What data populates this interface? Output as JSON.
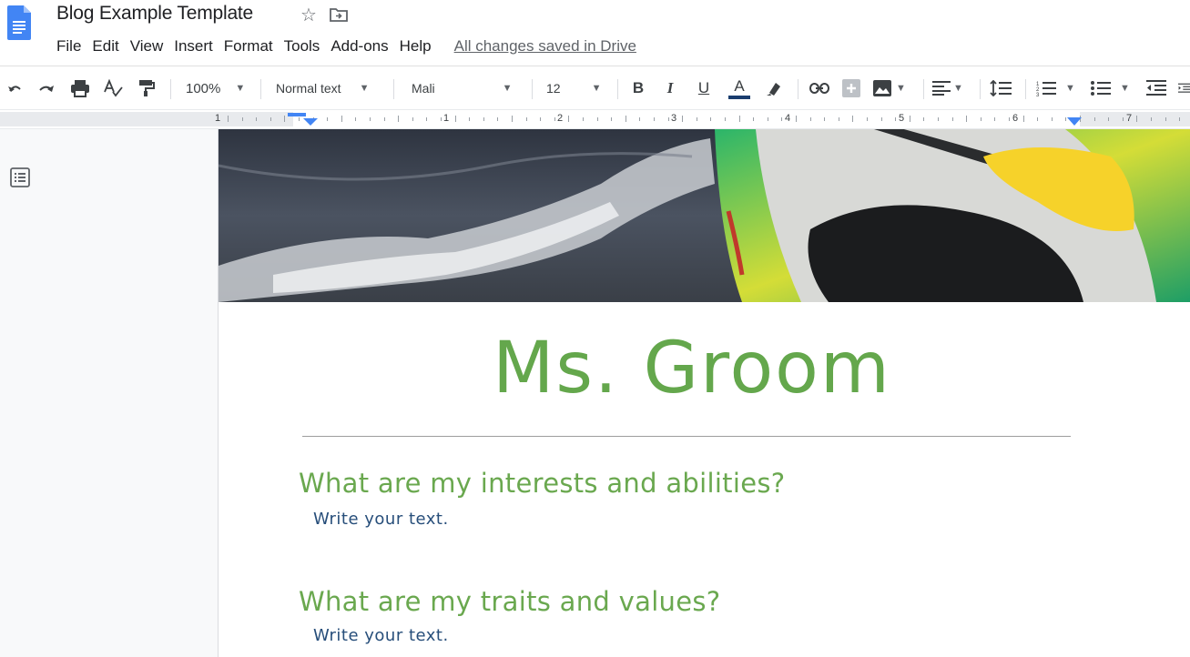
{
  "app": {
    "doc_title": "Blog Example Template",
    "save_status": "All changes saved in Drive"
  },
  "menu": [
    "File",
    "Edit",
    "View",
    "Insert",
    "Format",
    "Tools",
    "Add-ons",
    "Help"
  ],
  "toolbar": {
    "zoom": "100%",
    "style": "Normal text",
    "font": "Mali",
    "font_size": "12",
    "bold": "B",
    "italic": "I",
    "underline": "U",
    "text_color": "A"
  },
  "ruler": {
    "numbers": [
      "1",
      "1",
      "2",
      "3",
      "4",
      "5",
      "6",
      "7"
    ]
  },
  "document": {
    "heading": "Ms. Groom",
    "sections": [
      {
        "heading": "What are my interests and abilities?",
        "body": "Write your text."
      },
      {
        "heading": "What are my traits and values?",
        "body": "Write your text."
      }
    ]
  },
  "colors": {
    "heading_green": "#64a74c",
    "section_green": "#6aa84f",
    "body_blue": "#274e7a",
    "docs_blue": "#4285f4"
  }
}
